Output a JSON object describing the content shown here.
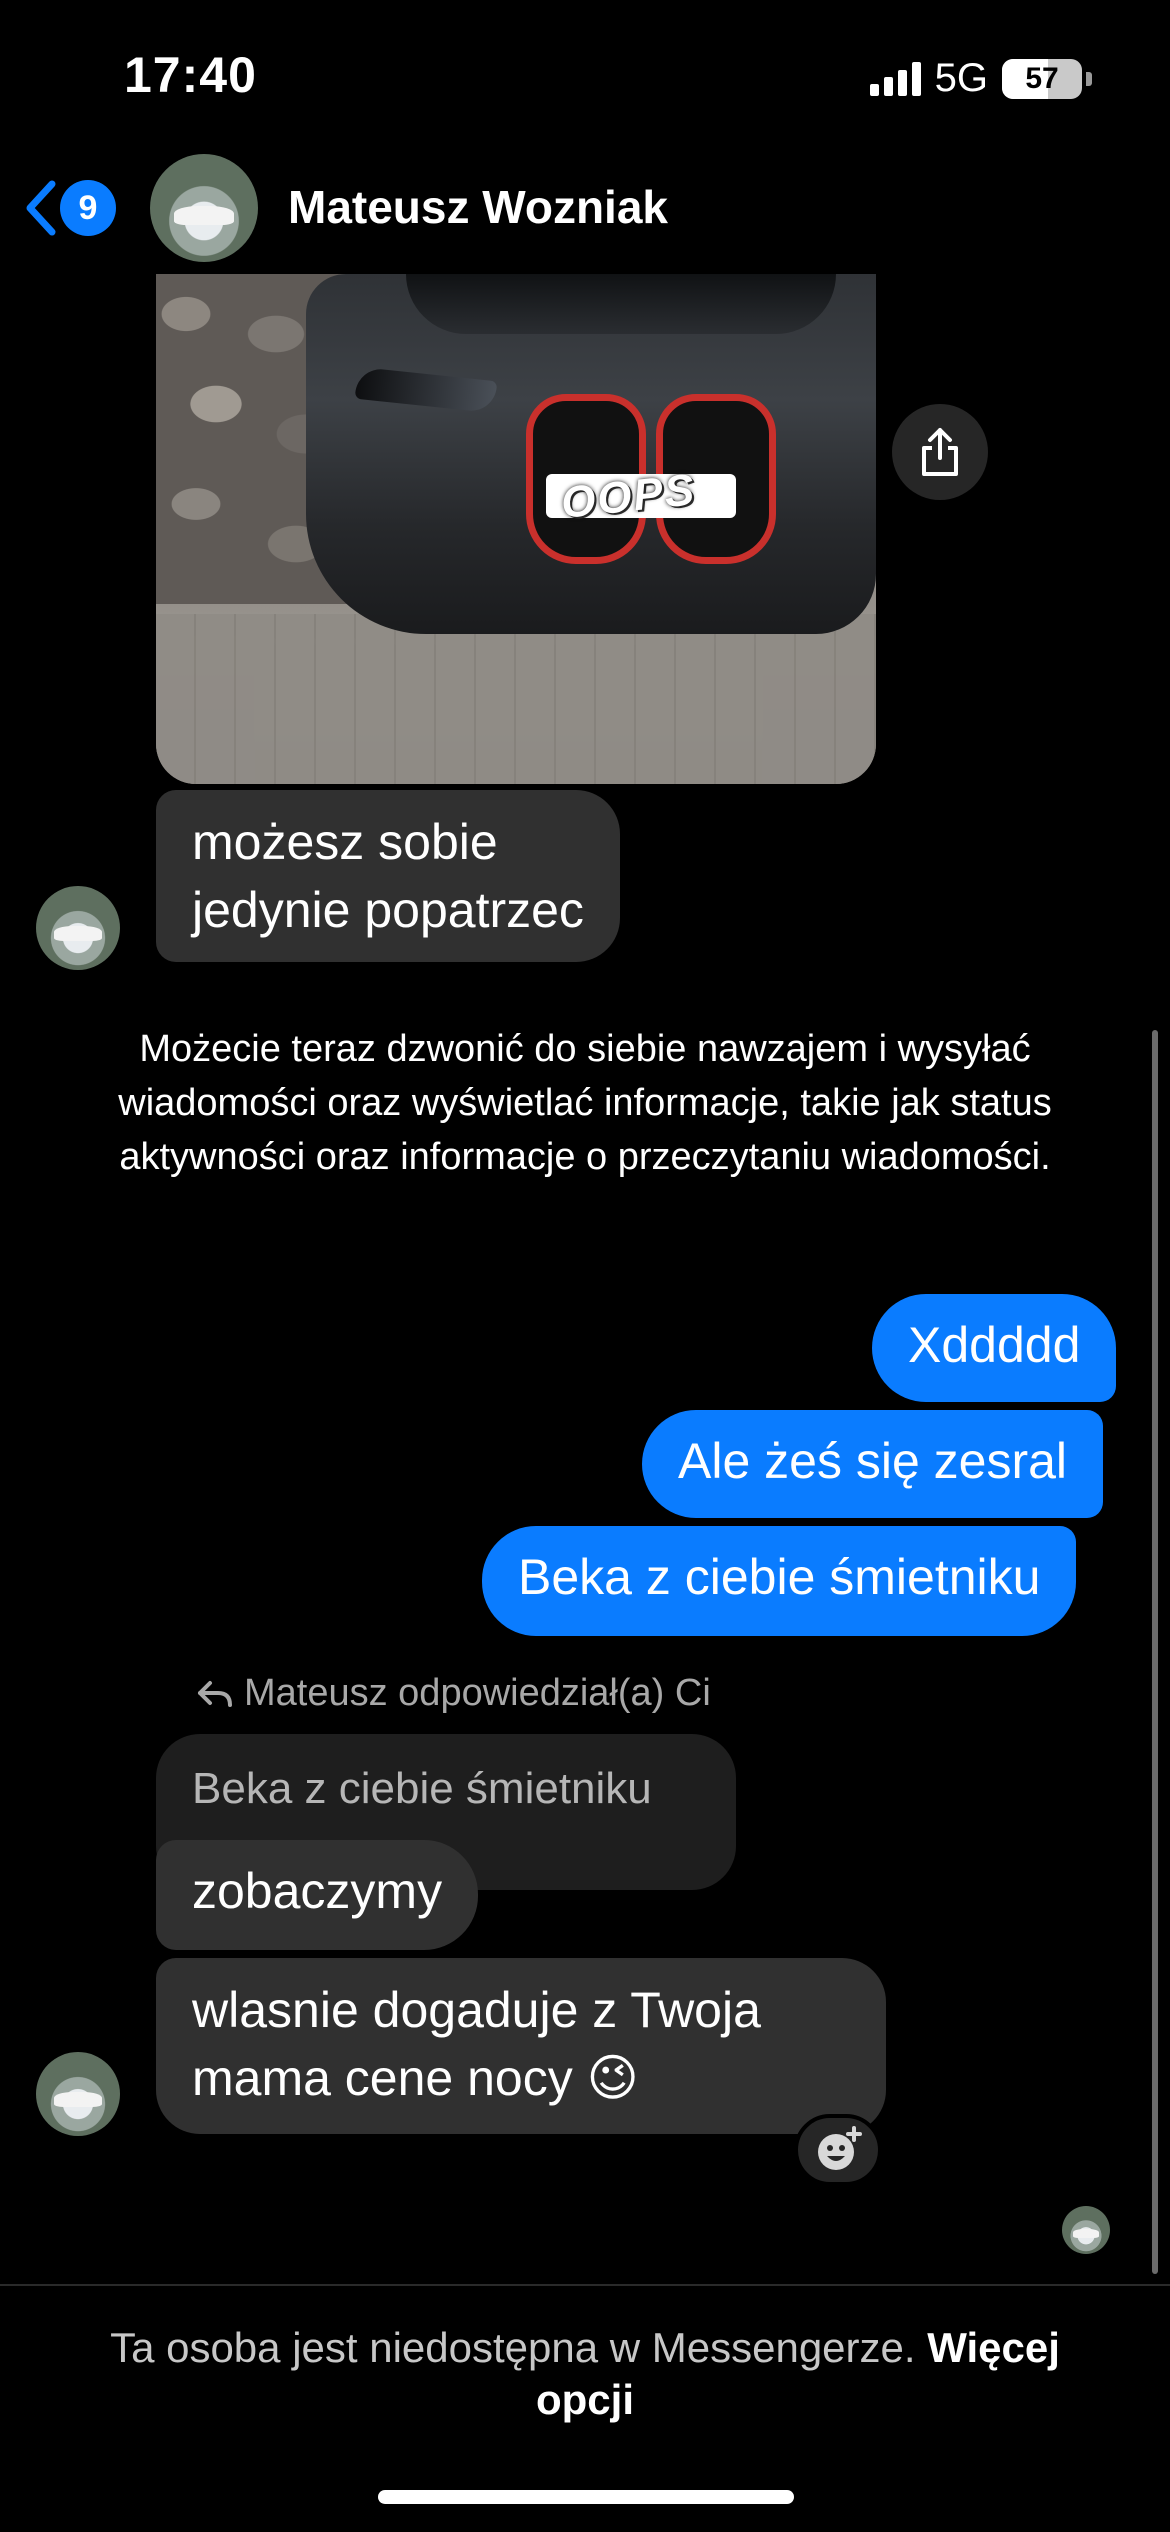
{
  "status_bar": {
    "time": "17:40",
    "network": "5G",
    "battery": "57",
    "battery_fraction": 0.57
  },
  "header": {
    "back_badge": "9",
    "contact_name": "Mateusz Wozniak"
  },
  "messages": {
    "incoming_1": "możesz sobie",
    "incoming_2": "jedynie popatrzec",
    "system_notice": "Możecie teraz dzwonić do siebie nawzajem i wysyłać wiadomości oraz wyświetlać informacje, takie jak status aktywności oraz informacje o przeczytaniu wiadomości.",
    "outgoing": [
      "Xddddd",
      "Ale żeś się zesral",
      "Beka z ciebie śmietniku"
    ],
    "reply_label": "Mateusz odpowiedział(a) Ci",
    "reply_quote": "Beka z ciebie śmietniku",
    "incoming_3": "zobaczymy",
    "incoming_4_line1": "wlasnie dogaduje z Twoja",
    "incoming_4_line2": "mama cene nocy 😉"
  },
  "footer": {
    "text": "Ta osoba jest niedostępna w Messengerze.",
    "link": "Więcej opcji"
  },
  "colors": {
    "background": "#000000",
    "outgoing_bubble": "#0a7cff",
    "incoming_bubble": "#303030",
    "accent": "#0a7cff"
  },
  "icons": {
    "back": "chevron-left-icon",
    "share": "share-icon",
    "reply": "reply-arrow-icon",
    "react": "add-reaction-icon"
  }
}
